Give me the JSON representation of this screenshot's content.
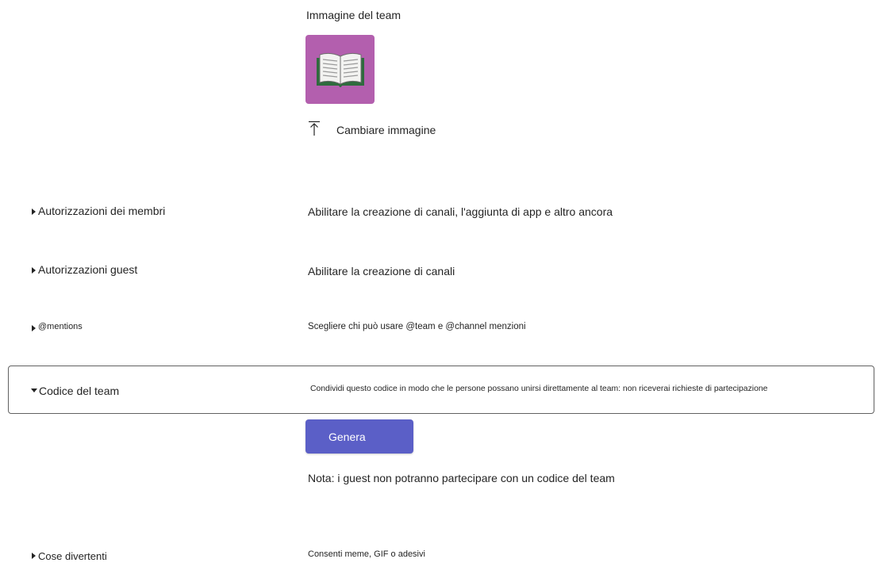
{
  "team_picture": {
    "label": "Immagine del team",
    "icon": "open-book-icon",
    "background_color": "#b35fae",
    "change_label": "Cambiare immagine",
    "change_icon": "upload-icon"
  },
  "sections": {
    "member_permissions": {
      "title": "Autorizzazioni dei membri",
      "description": "Abilitare la creazione di canali, l'aggiunta di app e altro ancora",
      "expanded": false
    },
    "guest_permissions": {
      "title": "Autorizzazioni guest",
      "description": "Abilitare la creazione di canali",
      "expanded": false
    },
    "mentions": {
      "title": "@mentions",
      "description": "Scegliere chi può usare @team e @channel menzioni",
      "expanded": false
    },
    "team_code": {
      "title": "Codice del team",
      "description": "Condividi questo codice in modo che le persone possano unirsi direttamente al team: non riceverai richieste di partecipazione",
      "expanded": true,
      "generate_label": "Genera",
      "note": "Nota: i guest non potranno partecipare con un codice del team"
    },
    "fun_stuff": {
      "title": "Cose divertenti",
      "description": "Consenti meme, GIF o adesivi",
      "expanded": false
    }
  },
  "colors": {
    "accent": "#5b5fc7",
    "text": "#242424",
    "border": "#616161"
  }
}
